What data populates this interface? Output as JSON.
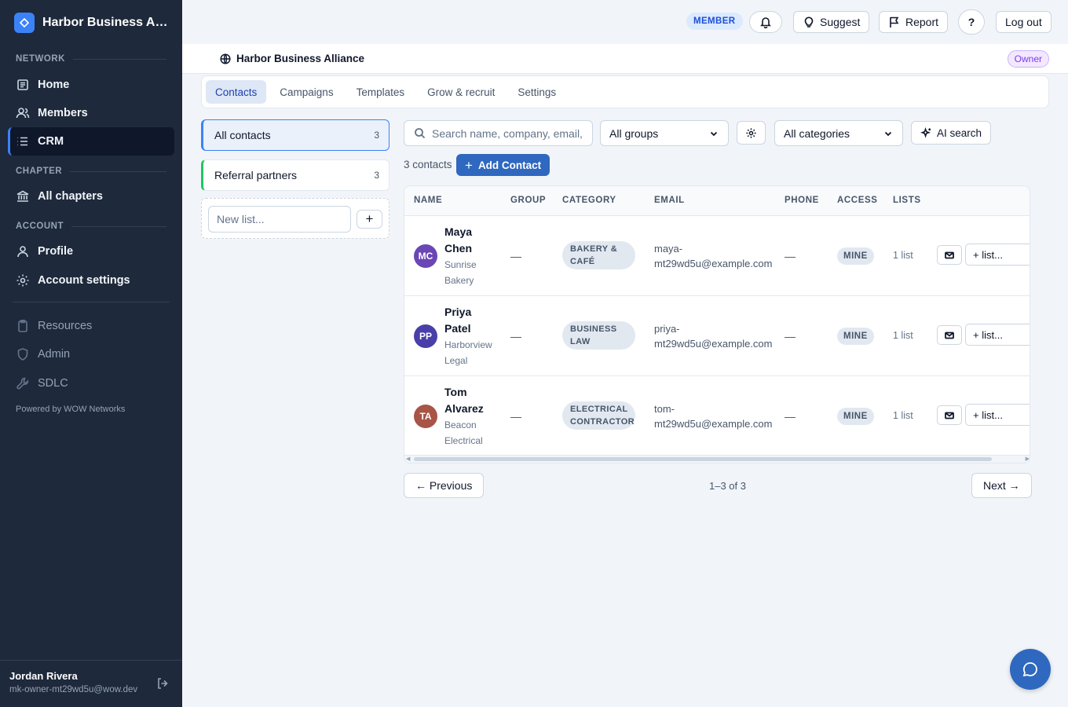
{
  "brand": {
    "name": "Harbor Business Allia..."
  },
  "sidebar": {
    "sections": {
      "network": "NETWORK",
      "chapter": "CHAPTER",
      "account": "ACCOUNT"
    },
    "items": {
      "home": "Home",
      "members": "Members",
      "crm": "CRM",
      "all_chapters": "All chapters",
      "profile": "Profile",
      "account_settings": "Account settings",
      "resources": "Resources",
      "admin": "Admin",
      "sdlc": "SDLC"
    },
    "powered_by": "Powered by WOW Networks",
    "user": {
      "name": "Jordan Rivera",
      "email": "mk-owner-mt29wd5u@wow.dev"
    }
  },
  "topbar": {
    "role_badge": "MEMBER",
    "suggest": "Suggest",
    "report": "Report",
    "help": "?",
    "logout": "Log out"
  },
  "org": {
    "title": "Harbor Business Alliance",
    "role": "Owner"
  },
  "tabs": [
    "Contacts",
    "Campaigns",
    "Templates",
    "Grow & recruit",
    "Settings"
  ],
  "lists": {
    "items": [
      {
        "label": "All contacts",
        "count": "3"
      },
      {
        "label": "Referral partners",
        "count": "3"
      }
    ],
    "new_placeholder": "New list...",
    "add_symbol": "+"
  },
  "filters": {
    "search_placeholder": "Search name, company, email,",
    "group": "All groups",
    "category": "All categories",
    "ai_search": "AI search"
  },
  "summary": {
    "count_text": "3 contacts",
    "add_contact": "Add Contact",
    "plus": "+"
  },
  "table": {
    "headers": [
      "NAME",
      "GROUP",
      "CATEGORY",
      "EMAIL",
      "PHONE",
      "ACCESS",
      "LISTS"
    ],
    "rows": [
      {
        "initials": "MC",
        "avatar_color": "#6b46b5",
        "first": "Maya",
        "last": "Chen",
        "company_1": "Sunrise",
        "company_2": "Bakery",
        "group": "—",
        "category_1": "BAKERY &",
        "category_2": "CAFÉ",
        "email_1": "maya-",
        "email_2": "mt29wd5u@example.com",
        "phone": "—",
        "access": "MINE",
        "lists": "1 list",
        "add_list": "+ list..."
      },
      {
        "initials": "PP",
        "avatar_color": "#4a3fa8",
        "first": "Priya",
        "last": "Patel",
        "company_1": "Harborview",
        "company_2": "Legal",
        "group": "—",
        "category_1": "BUSINESS",
        "category_2": "LAW",
        "email_1": "priya-",
        "email_2": "mt29wd5u@example.com",
        "phone": "—",
        "access": "MINE",
        "lists": "1 list",
        "add_list": "+ list..."
      },
      {
        "initials": "TA",
        "avatar_color": "#a85446",
        "first": "Tom",
        "last": "Alvarez",
        "company_1": "Beacon",
        "company_2": "Electrical",
        "group": "—",
        "category_1": "ELECTRICAL",
        "category_2": "CONTRACTOR",
        "email_1": "tom-",
        "email_2": "mt29wd5u@example.com",
        "phone": "—",
        "access": "MINE",
        "lists": "1 list",
        "add_list": "+ list..."
      }
    ]
  },
  "pagination": {
    "previous": "← Previous",
    "info": "1–3 of 3",
    "next": "Next →"
  }
}
